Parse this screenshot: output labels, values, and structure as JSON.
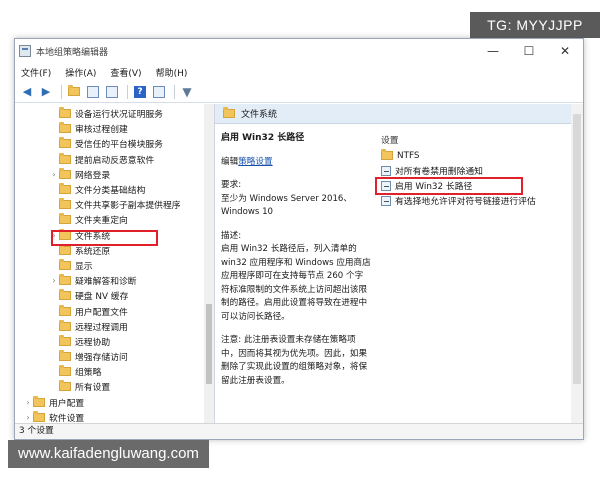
{
  "window": {
    "title": "本地组策略编辑器",
    "caption": {
      "minimize": "—",
      "maximize": "☐",
      "close": "✕"
    }
  },
  "menu": [
    "文件(F)",
    "操作(A)",
    "查看(V)",
    "帮助(H)"
  ],
  "toolbar": {
    "back_icon": "arrow-left-icon",
    "forward_icon": "arrow-right-icon",
    "help_label": "?"
  },
  "tree": {
    "items": [
      {
        "label": "设备运行状况证明服务",
        "arrow": ""
      },
      {
        "label": "审核过程创建",
        "arrow": ""
      },
      {
        "label": "受信任的平台模块服务",
        "arrow": ""
      },
      {
        "label": "提前启动反恶意软件",
        "arrow": ""
      },
      {
        "label": "网络登录",
        "arrow": "›"
      },
      {
        "label": "文件分类基础结构",
        "arrow": ""
      },
      {
        "label": "文件共享影子副本提供程序",
        "arrow": ""
      },
      {
        "label": "文件夹重定向",
        "arrow": ""
      },
      {
        "label": "文件系统",
        "arrow": "›",
        "selected": true
      },
      {
        "label": "系统还原",
        "arrow": ""
      },
      {
        "label": "显示",
        "arrow": ""
      },
      {
        "label": "疑难解答和诊断",
        "arrow": "›"
      },
      {
        "label": "硬盘 NV 缓存",
        "arrow": ""
      },
      {
        "label": "用户配置文件",
        "arrow": ""
      },
      {
        "label": "远程过程调用",
        "arrow": ""
      },
      {
        "label": "远程协助",
        "arrow": ""
      },
      {
        "label": "增强存储访问",
        "arrow": ""
      },
      {
        "label": "组策略",
        "arrow": ""
      },
      {
        "label": "所有设置",
        "arrow": ""
      },
      {
        "label": "用户配置",
        "arrow": "›"
      },
      {
        "label": "软件设置",
        "arrow": "›"
      }
    ]
  },
  "right": {
    "header": "文件系统",
    "policy_title": "启用 Win32 长路径",
    "edit_prefix": "编辑",
    "edit_link": "策略设置",
    "requirements_label": "要求:",
    "requirements_text": "至少为 Windows Server 2016、Windows 10",
    "description_label": "描述:",
    "description_text": "启用 Win32 长路径后，列入清单的 win32 应用程序和 Windows 应用商店应用程序即可在支持每节点 260 个字符标准限制的文件系统上访问超出该限制的路径。启用此设置将导致在进程中可以访问长路径。",
    "note_text": "注意: 此注册表设置未存储在策略项中，因而将其视为优先项。因此，如果删除了实现此设置的组策略对象，将保留此注册表设置。",
    "settings_header": "设置",
    "settings": [
      {
        "label": "NTFS",
        "type": "folder"
      },
      {
        "label": "对所有卷禁用删除通知",
        "type": "policy"
      },
      {
        "label": "启用 Win32 长路径",
        "type": "policy",
        "highlighted": true
      },
      {
        "label": "有选择地允许评对符号链接进行评估",
        "type": "policy"
      }
    ]
  },
  "tabs": [
    "扩展",
    "标准"
  ],
  "status": "3 个设置",
  "watermark": {
    "tg": "TG: MYYJJPP",
    "url": "www.kaifadengluwang.com"
  },
  "colors": {
    "highlight_box": "#e0202a",
    "header_band": "#e3edf8",
    "link": "#1550b0"
  }
}
